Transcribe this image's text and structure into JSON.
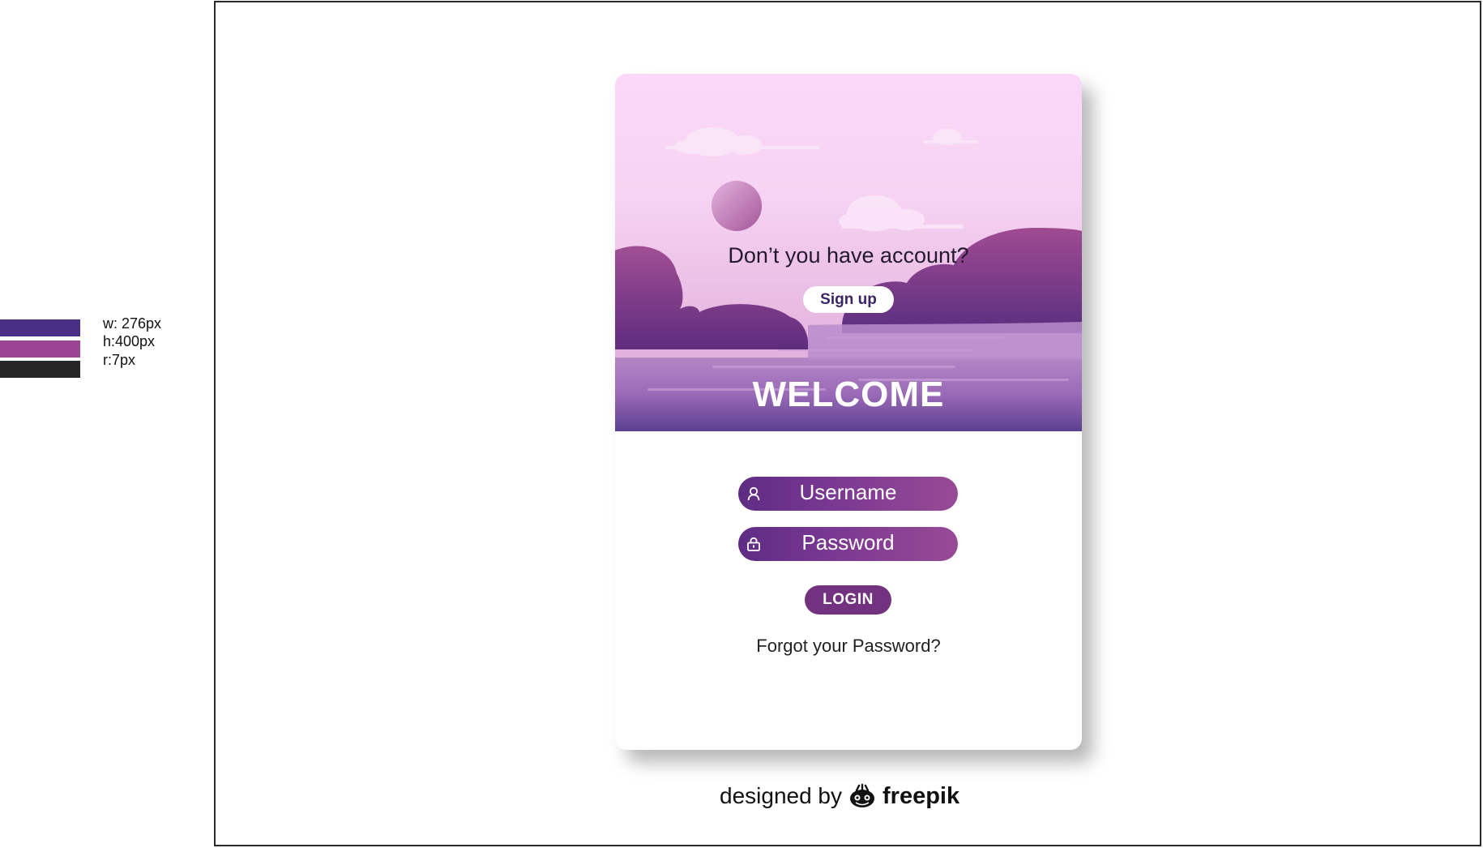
{
  "legend": {
    "swatches": [
      "#4a2f86",
      "#9b4494",
      "#262626"
    ],
    "width_label": "w: 276px",
    "height_label": "h:400px",
    "radius_label": "r:7px"
  },
  "hero": {
    "question": "Don’t you have account?",
    "signup_label": "Sign up",
    "welcome": "WELCOME"
  },
  "form": {
    "username_placeholder": "Username",
    "password_placeholder": "Password",
    "login_label": "LOGIN",
    "forgot_label": "Forgot your Password?"
  },
  "credit": {
    "prefix": "designed by",
    "brand": "freepik"
  },
  "colors": {
    "primary_purple": "#73327f",
    "accent_magenta": "#984a94",
    "deep_purple": "#4a2f86",
    "sky_pink": "#f9d6f6"
  },
  "icons": {
    "username": "user-icon",
    "password": "lock-icon",
    "brand": "freepik-logo-icon"
  }
}
